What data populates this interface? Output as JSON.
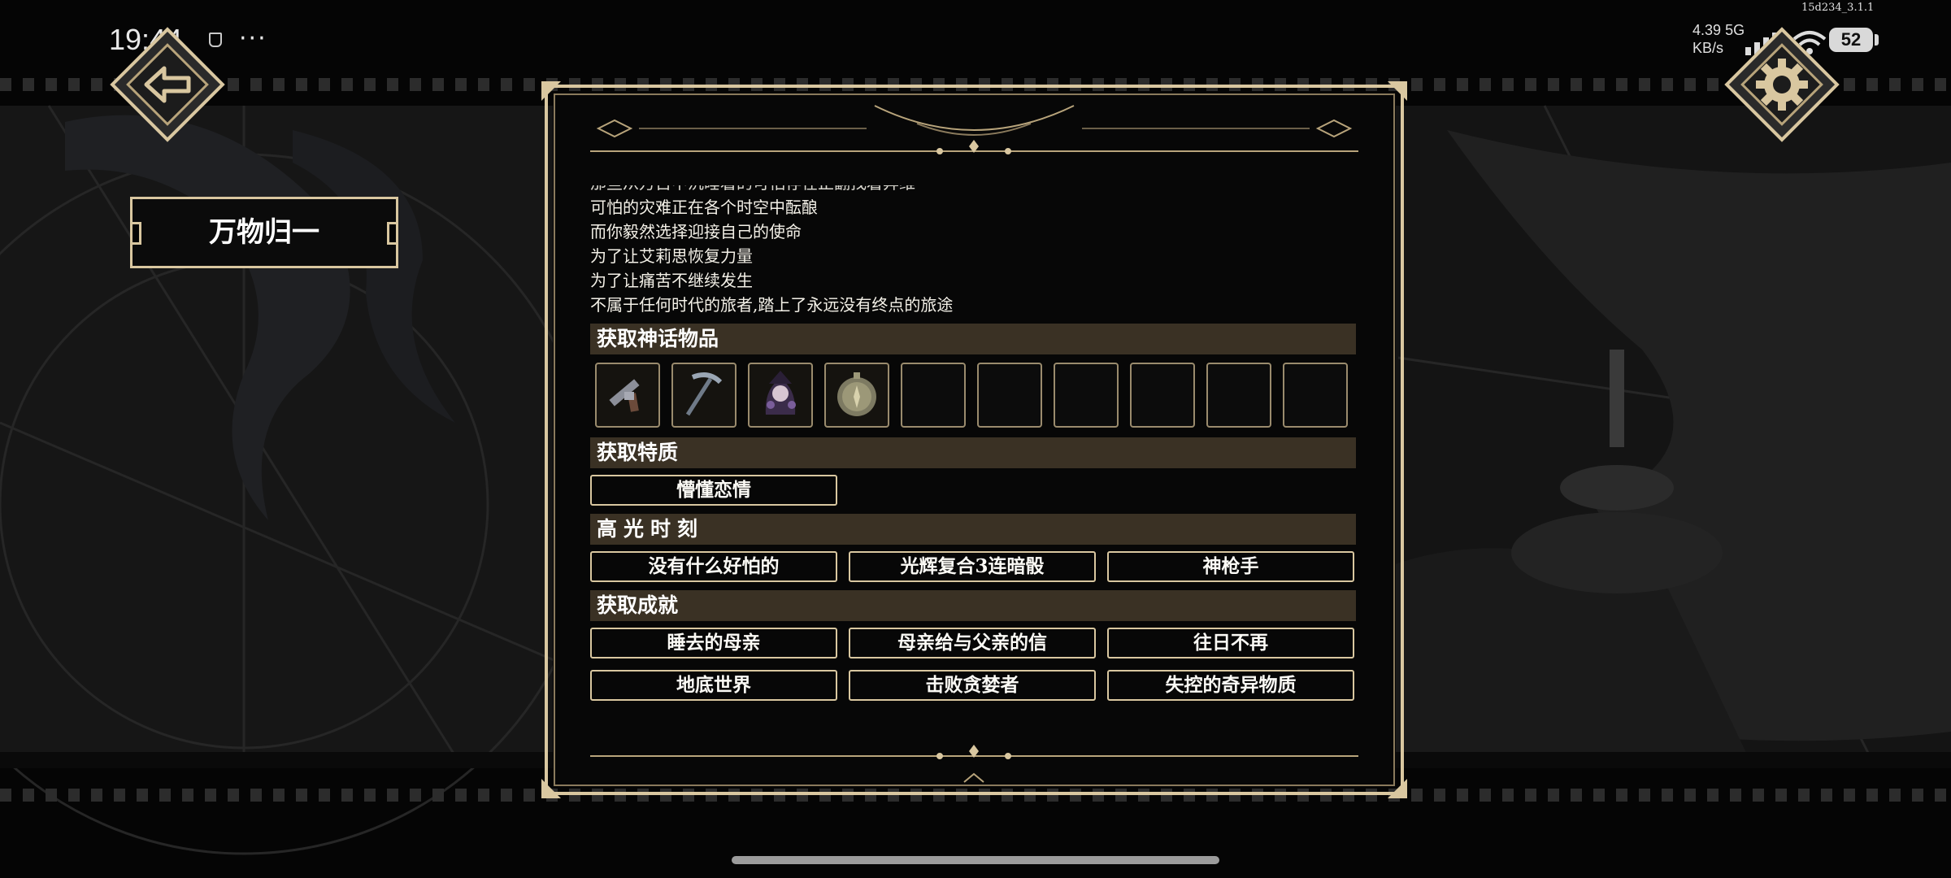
{
  "status_bar": {
    "time": "19:44",
    "dots": "···",
    "net_speed": "4.39",
    "net_unit": "KB/s",
    "net_type": "5G",
    "battery": "52",
    "build": "15d234_3.1.1"
  },
  "nav": {
    "back_icon": "back-arrow-icon",
    "settings_icon": "gear-icon"
  },
  "chapter": {
    "title": "万物归一"
  },
  "story": {
    "lines": [
      "那些从万古中沉睡着的可怕存在正翻找着异维",
      "可怕的灾难正在各个时空中酝酿",
      "而你毅然选择迎接自己的使命",
      "为了让艾莉思恢复力量",
      "为了让痛苦不继续发生",
      "不属于任何时代的旅者,踏上了永远没有终点的旅途"
    ]
  },
  "sections": {
    "mythic_items": {
      "header": "获取神话物品",
      "slots": [
        {
          "icon": "revolver-icon",
          "filled": true
        },
        {
          "icon": "pickaxe-icon",
          "filled": true
        },
        {
          "icon": "witch-portrait-icon",
          "filled": true
        },
        {
          "icon": "compass-orb-icon",
          "filled": true
        },
        {
          "icon": "",
          "filled": false
        },
        {
          "icon": "",
          "filled": false
        },
        {
          "icon": "",
          "filled": false
        },
        {
          "icon": "",
          "filled": false
        },
        {
          "icon": "",
          "filled": false
        },
        {
          "icon": "",
          "filled": false
        }
      ]
    },
    "traits": {
      "header": "获取特质",
      "items": [
        "懵懂恋情"
      ]
    },
    "highlights": {
      "header": "高光时刻",
      "items": [
        "没有什么好怕的",
        "光辉复合3连暗骰",
        "神枪手"
      ]
    },
    "achievements": {
      "header": "获取成就",
      "items": [
        "睡去的母亲",
        "母亲给与父亲的信",
        "往日不再",
        "地底世界",
        "击败贪婪者",
        "失控的奇异物质"
      ]
    }
  },
  "colors": {
    "gold_border": "#d9c7a0",
    "section_bar": "#3a3124",
    "background": "#050505"
  }
}
